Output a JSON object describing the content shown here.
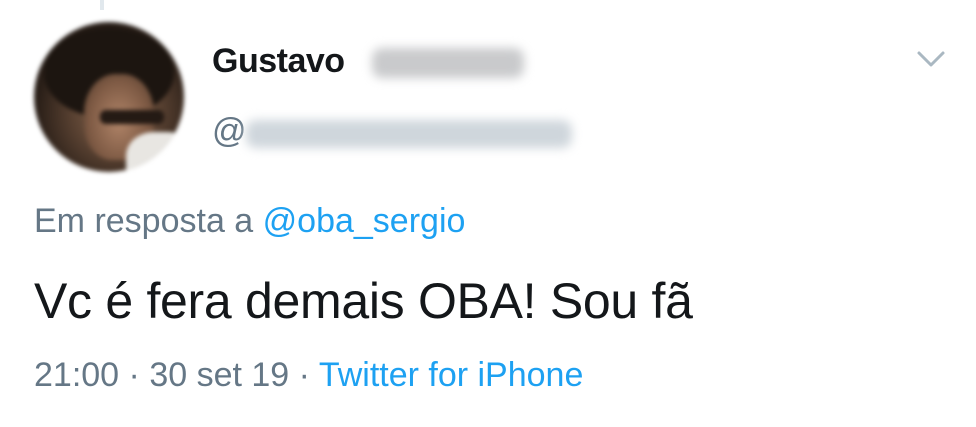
{
  "tweet": {
    "author": {
      "display_name": "Gustavo",
      "handle_prefix": "@"
    },
    "reply": {
      "prefix": "Em resposta a ",
      "mention": "@oba_sergio"
    },
    "text": "Vc é fera demais OBA! Sou fã",
    "meta": {
      "time": "21:00",
      "separator_1": " · ",
      "date": "30 set 19",
      "separator_2": " · ",
      "source": "Twitter for iPhone"
    }
  },
  "icons": {
    "menu": "chevron-down-icon",
    "avatar": "avatar"
  },
  "colors": {
    "text_primary": "#14171a",
    "text_secondary": "#657786",
    "link": "#1da1f2",
    "chevron": "#aab8c2"
  }
}
